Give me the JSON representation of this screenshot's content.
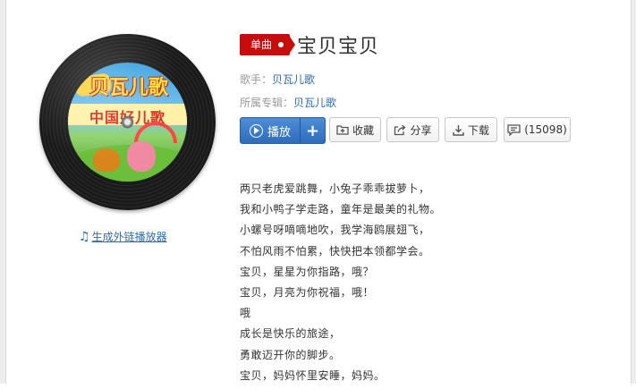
{
  "song": {
    "tag": "单曲",
    "title": "宝贝宝贝",
    "singer_label": "歌手：",
    "singer": "贝瓦儿歌",
    "album_label": "所属专辑：",
    "album": "贝瓦儿歌"
  },
  "cover": {
    "brand": "贝瓦儿歌",
    "subtitle": "中国好儿歌"
  },
  "external_link": "生成外链播放器",
  "actions": {
    "play": "播放",
    "add": "+",
    "collect": "收藏",
    "share": "分享",
    "download": "下载",
    "comment_count": "(15098)"
  },
  "lyrics": [
    "两只老虎爱跳舞，小兔子乖乖拔萝卜，",
    "我和小鸭子学走路，童年是最美的礼物。",
    "小螺号呀嘀嘀地吹，我学海鸥展翅飞，",
    "不怕风雨不怕累，快快把本领都学会。",
    "宝贝，星星为你指路，哦？",
    "宝贝，月亮为你祝福，哦！",
    "哦",
    "成长是快乐的旅途，",
    "勇敢迈开你的脚步。",
    "宝贝，妈妈怀里安睡，妈妈。"
  ],
  "colors": {
    "accent_red": "#c70c0c",
    "link_blue": "#2c6eb4",
    "play_blue": "#2d6cbc"
  }
}
